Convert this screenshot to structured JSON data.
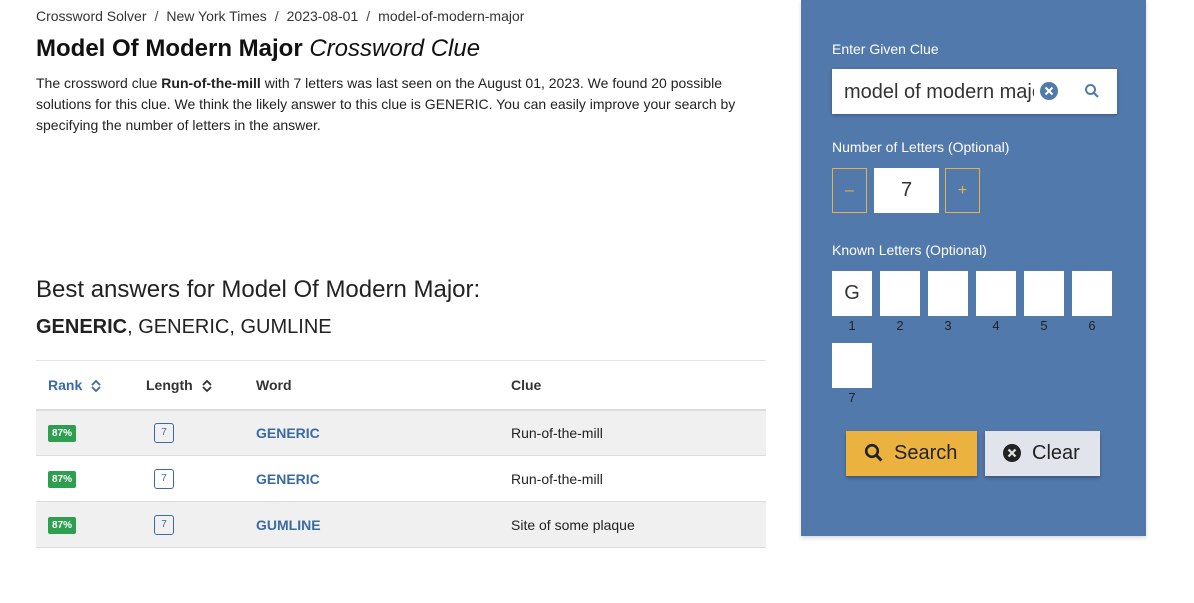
{
  "breadcrumb": [
    "Crossword Solver",
    "New York Times",
    "2023-08-01",
    "model-of-modern-major"
  ],
  "title": {
    "main": "Model Of Modern Major",
    "suffix": "Crossword Clue"
  },
  "intro": {
    "p1": "The crossword clue ",
    "clue": "Run-of-the-mill",
    "p2": " with 7 letters was last seen on the August 01, 2023. We found 20 possible solutions for this clue. We think the likely answer to this clue is GENERIC. You can easily improve your search by specifying the number of letters in the answer."
  },
  "best": {
    "heading": "Best answers for Model Of Modern Major:",
    "first": "GENERIC",
    "rest": ", GENERIC, GUMLINE"
  },
  "table": {
    "headers": {
      "rank": "Rank",
      "length": "Length",
      "word": "Word",
      "clue": "Clue"
    },
    "rows": [
      {
        "rank": "87%",
        "length": "7",
        "word": "GENERIC",
        "clue": "Run-of-the-mill"
      },
      {
        "rank": "87%",
        "length": "7",
        "word": "GENERIC",
        "clue": "Run-of-the-mill"
      },
      {
        "rank": "87%",
        "length": "7",
        "word": "GUMLINE",
        "clue": "Site of some plaque"
      }
    ]
  },
  "panel": {
    "clue_label": "Enter Given Clue",
    "clue_value": "model of modern major",
    "letters_label": "Number of Letters (Optional)",
    "minus": "–",
    "plus": "+",
    "letter_count": "7",
    "known_label": "Known Letters (Optional)",
    "known": [
      {
        "value": "G",
        "num": "1"
      },
      {
        "value": "",
        "num": "2"
      },
      {
        "value": "",
        "num": "3"
      },
      {
        "value": "",
        "num": "4"
      },
      {
        "value": "",
        "num": "5"
      },
      {
        "value": "",
        "num": "6"
      },
      {
        "value": "",
        "num": "7"
      }
    ],
    "search_label": "Search",
    "clear_label": "Clear"
  },
  "colors": {
    "panel": "#5279ab",
    "accent": "#ebb23f",
    "link": "#3a6aa6",
    "badge": "#2e9e4f"
  }
}
